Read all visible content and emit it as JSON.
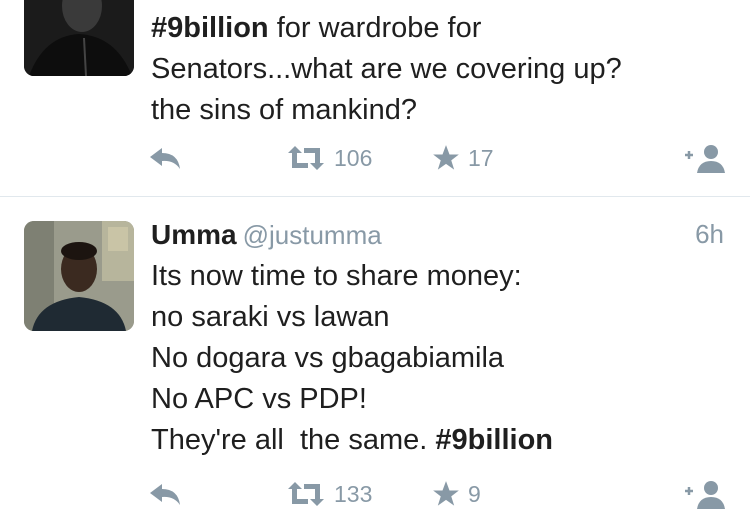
{
  "tweets": [
    {
      "text_lines": [
        {
          "hashtag": "#9billion",
          "rest": " for wardrobe for"
        },
        {
          "text": "Senators...what are we covering up?"
        },
        {
          "text": "the sins of mankind?"
        }
      ],
      "retweets": "106",
      "favorites": "17"
    },
    {
      "name": "Umma",
      "handle": "@justumma",
      "time": "6h",
      "text_lines": [
        "Its now time to share money:",
        "no saraki vs lawan",
        "No dogara vs gbagabiamila",
        "No APC vs PDP!"
      ],
      "last_line_text": "They're all  the same. ",
      "last_line_hashtag": "#9billion",
      "retweets": "133",
      "favorites": "9"
    }
  ],
  "icons": {
    "reply": "reply-icon",
    "retweet": "retweet-icon",
    "favorite": "star-icon",
    "follow": "add-user-icon"
  },
  "colors": {
    "icon_gray": "#8899a6",
    "text": "#1f1f1f",
    "divider": "#e1e8ed"
  }
}
